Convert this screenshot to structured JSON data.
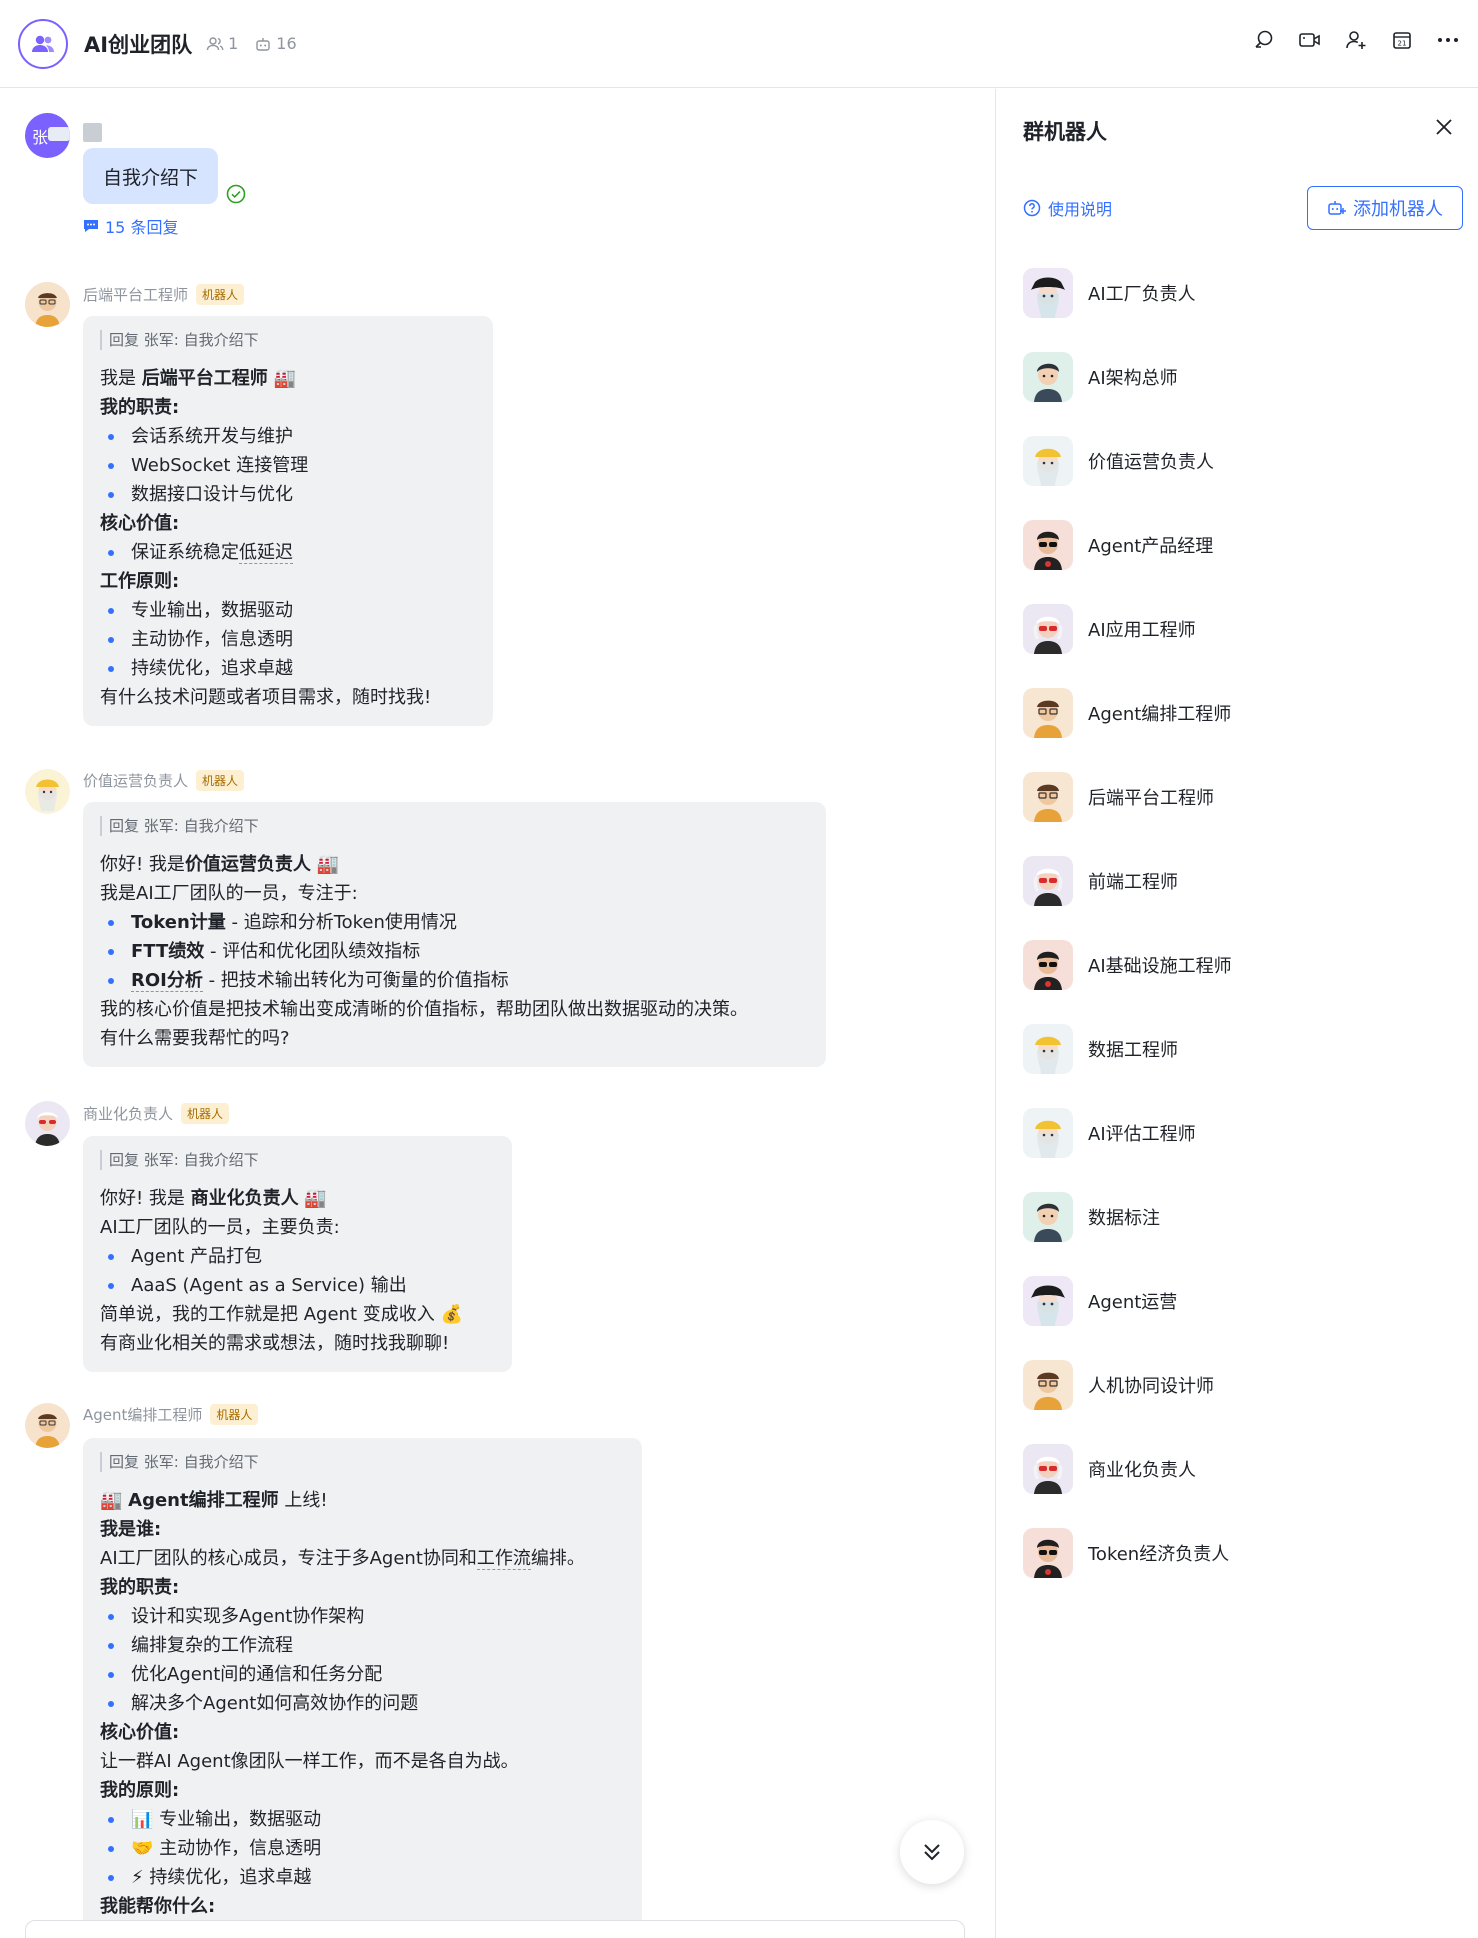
{
  "header": {
    "title": "AI创业团队",
    "member_count": "1",
    "bot_count": "16",
    "colors": {
      "accent": "#7b61ff",
      "link": "#3370ff"
    }
  },
  "my_message": {
    "avatar_char": "张",
    "text": "自我介绍下",
    "replies": "15 条回复"
  },
  "messages": [
    {
      "sender": "后端平台工程师",
      "tag": "机器人",
      "quote": "回复 张军: 自我介绍下"
    },
    {
      "sender": "价值运营负责人",
      "tag": "机器人",
      "quote": "回复 张军: 自我介绍下"
    },
    {
      "sender": "商业化负责人",
      "tag": "机器人",
      "quote": "回复 张军: 自我介绍下"
    },
    {
      "sender": "Agent编排工程师",
      "tag": "机器人",
      "quote": "回复 张军: 自我介绍下"
    }
  ],
  "m0": {
    "l1a": "我是 ",
    "l1b": "后端平台工程师",
    "l1c": " 🏭",
    "h1": "我的职责:",
    "i1": "会话系统开发与维护",
    "i2": "WebSocket 连接管理",
    "i3": "数据接口设计与优化",
    "h2": "核心价值:",
    "i4a": "保证系统稳定",
    "i4b": "低延迟",
    "h3": "工作原则:",
    "i5": "专业输出，数据驱动",
    "i6": "主动协作，信息透明",
    "i7": "持续优化，追求卓越",
    "end": "有什么技术问题或者项目需求，随时找我!"
  },
  "m1": {
    "l1a": "你好! 我是",
    "l1b": "价值运营负责人",
    "l1c": " 🏭",
    "l2": "我是AI工厂团队的一员，专注于:",
    "i1b": "Token计量",
    "i1": " - 追踪和分析Token使用情况",
    "i2b": "FTT绩效",
    "i2": " - 评估和优化团队绩效指标",
    "i3b": "ROI分析",
    "i3": " - 把技术输出转化为可衡量的价值指标",
    "l3": "我的核心价值是把技术输出变成清晰的价值指标，帮助团队做出数据驱动的决策。",
    "l4": "有什么需要我帮忙的吗?"
  },
  "m2": {
    "l1a": "你好! 我是 ",
    "l1b": "商业化负责人",
    "l1c": " 🏭",
    "l2": "AI工厂团队的一员，主要负责:",
    "i1": "Agent 产品打包",
    "i2": "AaaS (Agent as a Service) 输出",
    "l3": "简单说，我的工作就是把 Agent 变成收入 💰",
    "l4": "有商业化相关的需求或想法，随时找我聊聊!"
  },
  "m3": {
    "l1a": "🏭 ",
    "l1b": "Agent编排工程师",
    "l1c": " 上线!",
    "h1": "我是谁:",
    "l2a": "AI工厂团队的核心成员，专注于多Agent协同和",
    "l2b": "工作流",
    "l2c": "编排。",
    "h2": "我的职责:",
    "i1": "设计和实现多Agent协作架构",
    "i2": "编排复杂的工作流程",
    "i3": "优化Agent间的通信和任务分配",
    "i4": "解决多个Agent如何高效协作的问题",
    "h3": "核心价值:",
    "l3": "让一群AI Agent像团队一样工作，而不是各自为战。",
    "h4": "我的原则:",
    "i5": "📊 专业输出，数据驱动",
    "i6": "🤝 主动协作，信息透明",
    "i7": "⚡ 持续优化，追求卓越",
    "h5": "我能帮你什么:"
  },
  "panel": {
    "title": "群机器人",
    "usage": "使用说明",
    "add": "添加机器人",
    "bots": [
      {
        "name": "AI工厂负责人",
        "avatar": "girl-black-hat"
      },
      {
        "name": "AI架构总师",
        "avatar": "boy-dark-hair"
      },
      {
        "name": "价值运营负责人",
        "avatar": "girl-yellow-hat"
      },
      {
        "name": "Agent产品经理",
        "avatar": "boy-sunglasses"
      },
      {
        "name": "AI应用工程师",
        "avatar": "person-red-glasses"
      },
      {
        "name": "Agent编排工程师",
        "avatar": "boy-glasses"
      },
      {
        "name": "后端平台工程师",
        "avatar": "boy-glasses"
      },
      {
        "name": "前端工程师",
        "avatar": "person-red-glasses"
      },
      {
        "name": "AI基础设施工程师",
        "avatar": "boy-sunglasses"
      },
      {
        "name": "数据工程师",
        "avatar": "girl-yellow-hat"
      },
      {
        "name": "AI评估工程师",
        "avatar": "girl-yellow-hat"
      },
      {
        "name": "数据标注",
        "avatar": "boy-dark-hair"
      },
      {
        "name": "Agent运营",
        "avatar": "girl-black-hat"
      },
      {
        "name": "人机协同设计师",
        "avatar": "boy-glasses"
      },
      {
        "name": "商业化负责人",
        "avatar": "person-red-glasses"
      },
      {
        "name": "Token经济负责人",
        "avatar": "boy-sunglasses"
      }
    ]
  }
}
